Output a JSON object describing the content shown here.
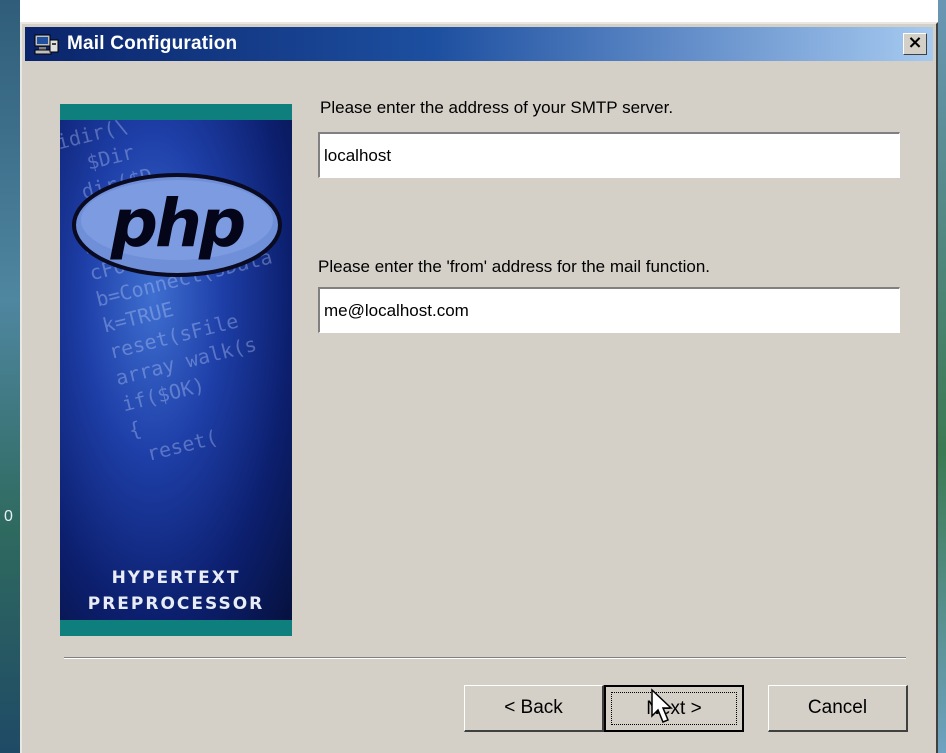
{
  "window": {
    "title": "Mail Configuration",
    "close_label": "×"
  },
  "banner": {
    "logo_text": "php",
    "caption_line1": "HYPERTEXT",
    "caption_line2": "PREPROCESSOR",
    "code_text": "idir(\\\n  $Dir\n dir($D\nopen(sfi\nwhile(s\ncFor(sfile\nb=Connect(sData\nk=TRUE\nreset(sFile\narray walk(s\nif($OK)\n{\n reset(\n"
  },
  "form": {
    "smtp_label": "Please enter the address of your SMTP server.",
    "smtp_value": "localhost",
    "from_label": "Please enter the 'from' address for the mail function.",
    "from_value": "me@localhost.com"
  },
  "buttons": {
    "back_label": "< Back",
    "next_label": "Next >",
    "cancel_label": "Cancel"
  },
  "desktop": {
    "left_edge_text": "0"
  }
}
